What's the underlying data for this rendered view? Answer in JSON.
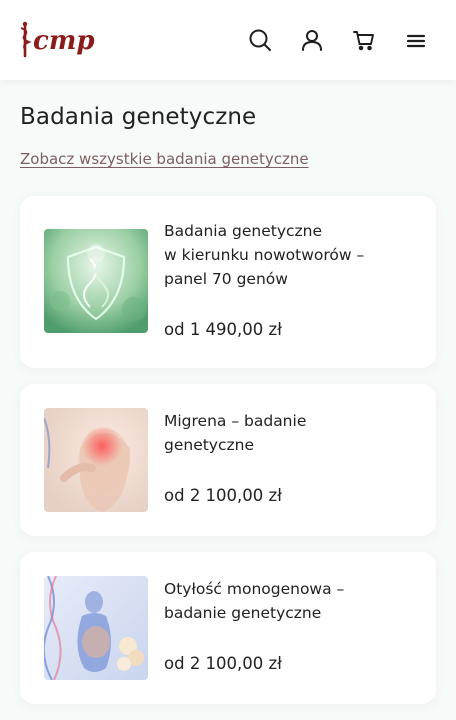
{
  "header": {
    "logo_text": "cmp",
    "icons": [
      "search-icon",
      "user-icon",
      "cart-icon",
      "menu-icon"
    ],
    "brand_color": "#8b1c1c"
  },
  "main": {
    "title": "Badania genetyczne",
    "see_all_link": "Zobacz wszystkie badania genetyczne"
  },
  "products": [
    {
      "title_lines": [
        "Badania genetyczne",
        "w kierunku nowotworów –",
        "panel 70 genów"
      ],
      "price": "od 1 490,00 zł"
    },
    {
      "title_lines": [
        "Migrena – badanie",
        "genetyczne"
      ],
      "price": "od 2 100,00 zł"
    },
    {
      "title_lines": [
        "Otyłość monogenowa –",
        "badanie genetyczne"
      ],
      "price": "od 2 100,00 zł"
    }
  ]
}
